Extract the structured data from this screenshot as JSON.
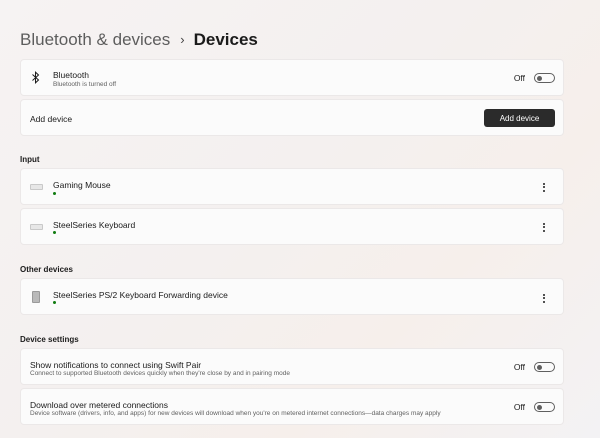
{
  "breadcrumb": {
    "parent": "Bluetooth & devices",
    "separator": "›",
    "current": "Devices"
  },
  "bluetooth": {
    "title": "Bluetooth",
    "subtitle": "Bluetooth is turned off",
    "toggle_state": "Off",
    "icon": "bluetooth-icon"
  },
  "add_device": {
    "label": "Add device",
    "button_label": "Add device"
  },
  "input_section": {
    "heading": "Input",
    "devices": [
      {
        "name": "Gaming Mouse",
        "icon": "keyboard-icon",
        "connected": true
      },
      {
        "name": "SteelSeries Keyboard",
        "icon": "keyboard-icon",
        "connected": true
      }
    ]
  },
  "other_section": {
    "heading": "Other devices",
    "devices": [
      {
        "name": "SteelSeries PS/2 Keyboard Forwarding device",
        "icon": "device-icon",
        "connected": true
      }
    ]
  },
  "settings_section": {
    "heading": "Device settings",
    "swift_pair": {
      "title": "Show notifications to connect using Swift Pair",
      "subtitle": "Connect to supported Bluetooth devices quickly when they're close by and in pairing mode",
      "toggle_state": "Off"
    },
    "metered": {
      "title": "Download over metered connections",
      "subtitle": "Device software (drivers, info, and apps) for new devices will download when you're on metered internet connections—data charges may apply",
      "toggle_state": "Off"
    }
  },
  "colors": {
    "accent_dark": "#2b2b2b",
    "connected_dot": "#0f7b0f",
    "card_bg": "#fbfbfb"
  }
}
